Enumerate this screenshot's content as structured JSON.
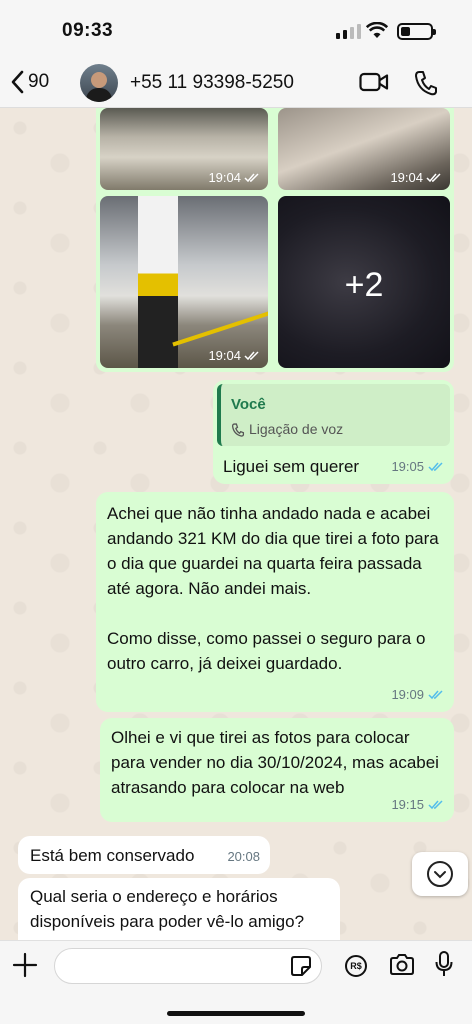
{
  "status_bar": {
    "time": "09:33"
  },
  "header": {
    "back_count": "90",
    "contact_name": "+55 11 93398-5250"
  },
  "photos": {
    "items": [
      {
        "time": "19:04"
      },
      {
        "time": "19:04"
      },
      {
        "time": "19:04"
      },
      {
        "time": "19:04",
        "more_count": "+2"
      }
    ]
  },
  "messages": [
    {
      "direction": "outgoing",
      "quote_sender": "Você",
      "quote_text": "Ligação de voz",
      "text": "Liguei sem querer",
      "time": "19:05"
    },
    {
      "direction": "outgoing",
      "text": "Achei que não tinha andado nada e acabei andando 321 KM do dia que tirei a foto para o dia que guardei na quarta feira passada até agora. Não andei mais.\n\nComo disse, como passei o seguro para o outro carro, já deixei guardado.",
      "time": "19:09"
    },
    {
      "direction": "outgoing",
      "text": "Olhei e vi que tirei as fotos para colocar para vender no dia 30/10/2024, mas acabei atrasando para colocar na web",
      "time": "19:15"
    },
    {
      "direction": "incoming",
      "text": "Está bem conservado",
      "time": "20:08"
    },
    {
      "direction": "incoming",
      "text": "Qual seria o endereço e horários disponíveis para poder vê-lo amigo?"
    }
  ],
  "input_bar": {
    "rs_label": "R$"
  },
  "colors": {
    "outgoing_bubble": "#d9fdd3",
    "incoming_bubble": "#ffffff",
    "read_ticks": "#53bdeb",
    "quote_accent": "#1f7a4d"
  }
}
